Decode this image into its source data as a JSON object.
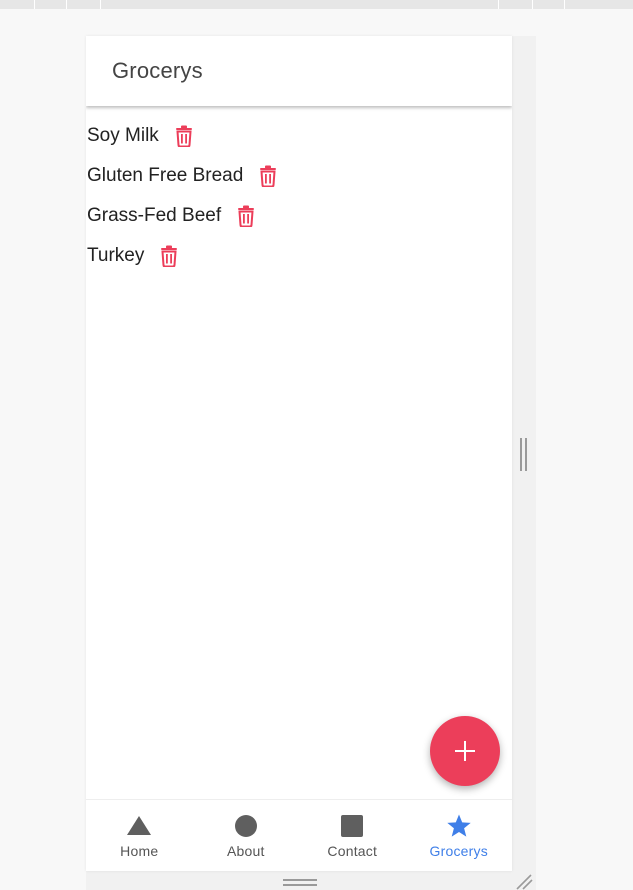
{
  "app": {
    "title": "Grocerys"
  },
  "groceries": {
    "items": [
      {
        "label": "Soy Milk"
      },
      {
        "label": "Gluten Free Bread"
      },
      {
        "label": "Grass-Fed Beef"
      },
      {
        "label": "Turkey"
      }
    ],
    "delete_icon": "trash-icon",
    "add_icon": "plus-icon"
  },
  "nav": {
    "items": [
      {
        "label": "Home",
        "icon": "triangle-icon",
        "active": false
      },
      {
        "label": "About",
        "icon": "circle-icon",
        "active": false
      },
      {
        "label": "Contact",
        "icon": "square-icon",
        "active": false
      },
      {
        "label": "Grocerys",
        "icon": "star-icon",
        "active": true
      }
    ]
  },
  "colors": {
    "accent_red": "#ec3e5a",
    "active_blue": "#3f7fe8",
    "icon_gray": "#5f5f5f",
    "title_text": "#444444"
  }
}
